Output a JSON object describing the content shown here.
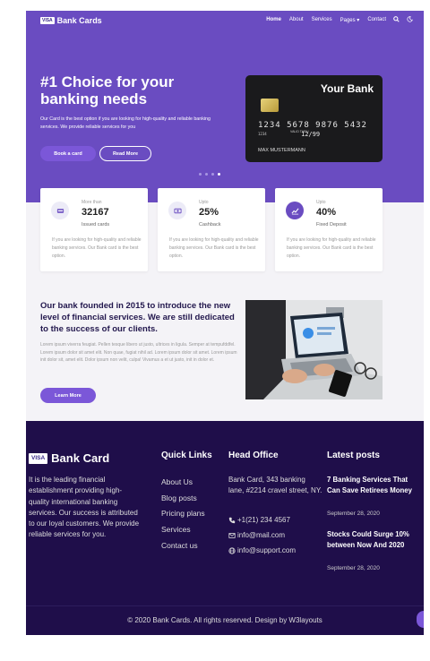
{
  "nav": {
    "brand_badge": "VISA",
    "brand": "Bank Cards",
    "items": [
      {
        "label": "Home"
      },
      {
        "label": "About"
      },
      {
        "label": "Services"
      },
      {
        "label": "Pages ▾"
      },
      {
        "label": "Contact"
      }
    ]
  },
  "hero": {
    "title": "#1 Choice for your banking needs",
    "description": "Our Card is the best option if you are looking for high-quality and reliable banking services. We provide reliable services for you",
    "book_label": "Book a card",
    "read_label": "Read More",
    "slides": 4,
    "active_slide": 4
  },
  "card": {
    "brand": "Your Bank",
    "number": "1234 5678 9876 5432",
    "small": "1234",
    "valid": "VALID THRU",
    "expiry": "12/99",
    "holder": "MAX MUSTERMANN"
  },
  "features": [
    {
      "pre": "More than",
      "value": "32167",
      "sub": "Issued cards",
      "text": "If you are looking for high-quality and reliable banking services. Our Bank card is the best option.",
      "icon": "visa-icon"
    },
    {
      "pre": "Upto",
      "value": "25%",
      "sub": "Cashback",
      "text": "If you are looking for high-quality and reliable banking services. Our Bank card is the best option.",
      "icon": "cash-icon"
    },
    {
      "pre": "Upto",
      "value": "40%",
      "sub": "Fixed Deposit",
      "text": "If you are looking for high-quality and reliable banking services. Our Bank card is the best option.",
      "icon": "chart-icon"
    }
  ],
  "about": {
    "title": "Our bank founded in 2015 to introduce the new level of financial services. We are still dedicated to the success of our clients.",
    "text": "Lorem ipsum viverra feugiat. Pellen tesque libero ut justo, ultrices in ligula. Semper at tempufddfel. Lorem ipsum dolor sit amet elit. Non quae, fugiat nihil ad. Lorem ipsum dolor sit amet. Lorem ipsum init dolor sit, amet elit. Dolor ipsum non velit, culpa! Vivamus a et ut justo, init in dolor et.",
    "button": "Learn More"
  },
  "footer": {
    "brand_badge": "VISA",
    "brand": "Bank Card",
    "description": "It is the leading financial establishment providing high-quality international banking services. Our success is attributed to our loyal customers. We provide reliable services for you.",
    "quick_title": "Quick Links",
    "quick_links": [
      "About Us",
      "Blog posts",
      "Pricing plans",
      "Services",
      "Contact us"
    ],
    "office_title": "Head Office",
    "address": "Bank Card, 343 banking lane, #2214 cravel street, NY.",
    "phone": "+1(21) 234 4567",
    "email": "info@mail.com",
    "web": "info@support.com",
    "posts_title": "Latest posts",
    "posts": [
      {
        "title": "7 Banking Services That Can Save Retirees Money",
        "date": "September 28, 2020"
      },
      {
        "title": "Stocks Could Surge 10% between Now And 2020",
        "date": "September 28, 2020"
      }
    ],
    "copyright": "© 2020 Bank Cards. All rights reserved. Design by W3layouts"
  }
}
